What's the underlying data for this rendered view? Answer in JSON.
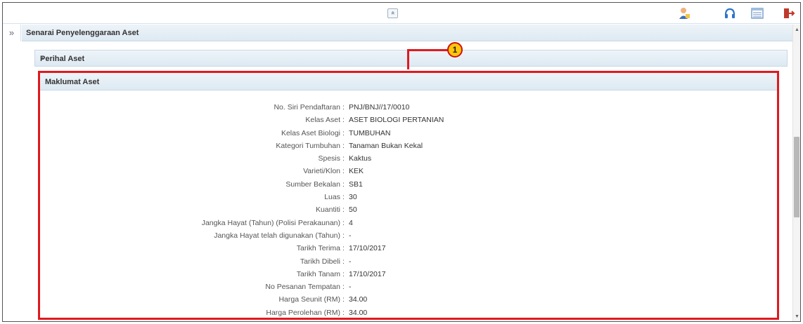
{
  "toolbar": {
    "collapse_glyph": "»",
    "icons": [
      "user-icon",
      "help-icon",
      "calendar-icon",
      "logout-icon"
    ]
  },
  "sidebar": {
    "toggle_glyph": "»"
  },
  "main": {
    "title": "Senarai Penyelenggaraan Aset"
  },
  "perihal": {
    "title": "Perihal Aset"
  },
  "maklumat": {
    "title": "Maklumat Aset",
    "fields": [
      {
        "label": "No. Siri Pendaftaran",
        "value": "PNJ/BNJ//17/0010"
      },
      {
        "label": "Kelas Aset",
        "value": "ASET BIOLOGI PERTANIAN"
      },
      {
        "label": "Kelas Aset Biologi",
        "value": "TUMBUHAN"
      },
      {
        "label": "Kategori Tumbuhan",
        "value": "Tanaman Bukan Kekal"
      },
      {
        "label": "Spesis",
        "value": "Kaktus"
      },
      {
        "label": "Varieti/Klon",
        "value": "KEK"
      },
      {
        "label": "Sumber Bekalan",
        "value": "SB1"
      },
      {
        "label": "Luas",
        "value": "30"
      },
      {
        "label": "Kuantiti",
        "value": "50"
      },
      {
        "label": "Jangka Hayat (Tahun) (Polisi Perakaunan)",
        "value": "4"
      },
      {
        "label": "Jangka Hayat telah digunakan (Tahun)",
        "value": "-"
      },
      {
        "label": "Tarikh Terima",
        "value": "17/10/2017"
      },
      {
        "label": "Tarikh Dibeli",
        "value": "-"
      },
      {
        "label": "Tarikh Tanam",
        "value": "17/10/2017"
      },
      {
        "label": "No Pesanan Tempatan",
        "value": "-"
      },
      {
        "label": "Harga Seunit (RM)",
        "value": "34.00"
      },
      {
        "label": "Harga Perolehan (RM)",
        "value": "34.00"
      }
    ]
  },
  "callout": {
    "number": "1"
  },
  "colors": {
    "highlight": "#e0191f",
    "badge": "#ffc60a",
    "header_bg": "#dde9f2"
  }
}
